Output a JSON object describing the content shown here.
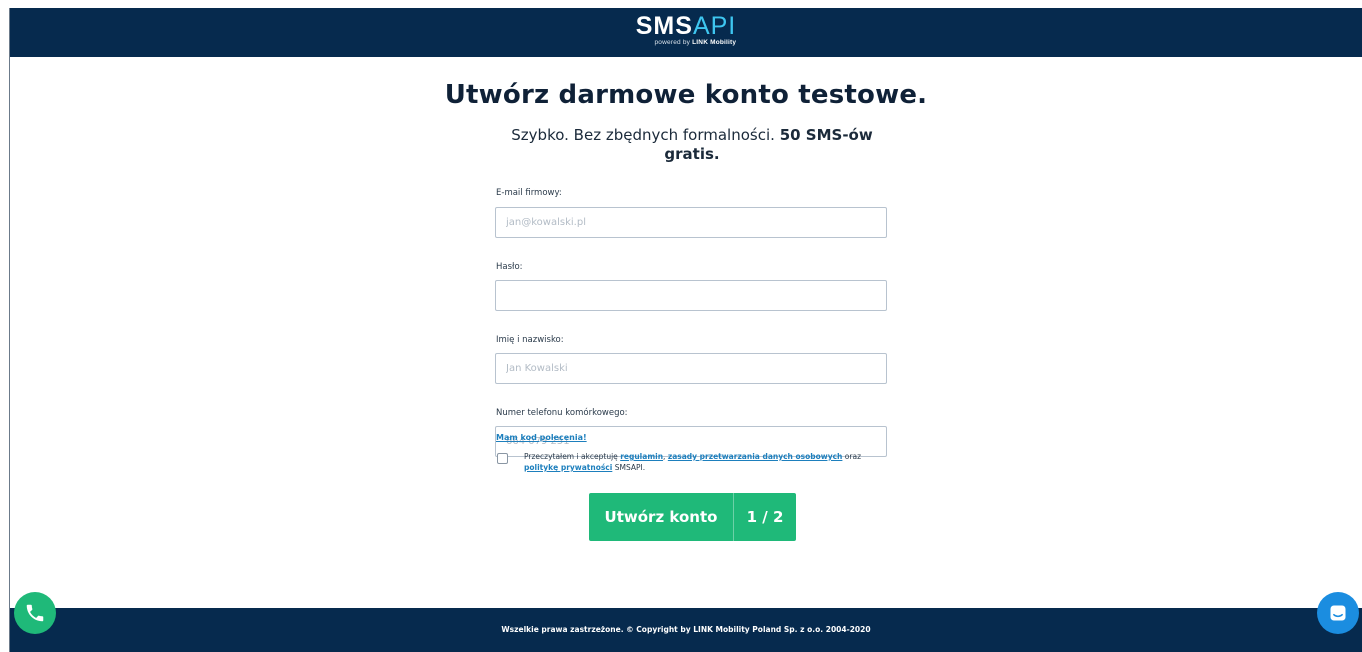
{
  "header": {
    "logo_main_prefix": "SMS",
    "logo_main_accent": "API",
    "logo_sub_prefix": "powered by",
    "logo_sub_brand": "LINK Mobility"
  },
  "page": {
    "title": "Utwórz darmowe konto testowe.",
    "subtitle_plain": "Szybko. Bez zbędnych formalności.",
    "subtitle_bold": "50 SMS-ów gratis."
  },
  "form": {
    "email": {
      "label": "E-mail firmowy:",
      "placeholder": "jan@kowalski.pl",
      "value": ""
    },
    "password": {
      "label": "Hasło:",
      "placeholder": "",
      "value": ""
    },
    "name": {
      "label": "Imię i nazwisko:",
      "placeholder": "Jan Kowalski",
      "value": ""
    },
    "phone": {
      "label": "Numer telefonu komórkowego:",
      "placeholder": "664 079 251",
      "value": ""
    },
    "referral_link": "Mam kod polecenia!",
    "consent": {
      "text_1": "Przeczytałem i akceptuję",
      "link_terms": "regulamin",
      "sep_1": ",",
      "link_privacy_rules": "zasady przetwarzania danych osobowych",
      "text_2": "oraz",
      "link_privacy_policy": "politykę prywatności",
      "text_3": "SMSAPI.",
      "checked": false
    },
    "submit_label": "Utwórz konto",
    "submit_step": "1 / 2"
  },
  "footer": {
    "copyright": "Wszelkie prawa zastrzeżone. © Copyright by LINK Mobility Poland Sp. z o.o. 2004-2020"
  },
  "widgets": {
    "phone_icon": "phone-icon",
    "chat_icon": "chat-icon"
  },
  "colors": {
    "navy": "#062a4e",
    "green": "#1fb979",
    "link": "#1d7fbd",
    "chat_blue": "#1b8de0"
  }
}
